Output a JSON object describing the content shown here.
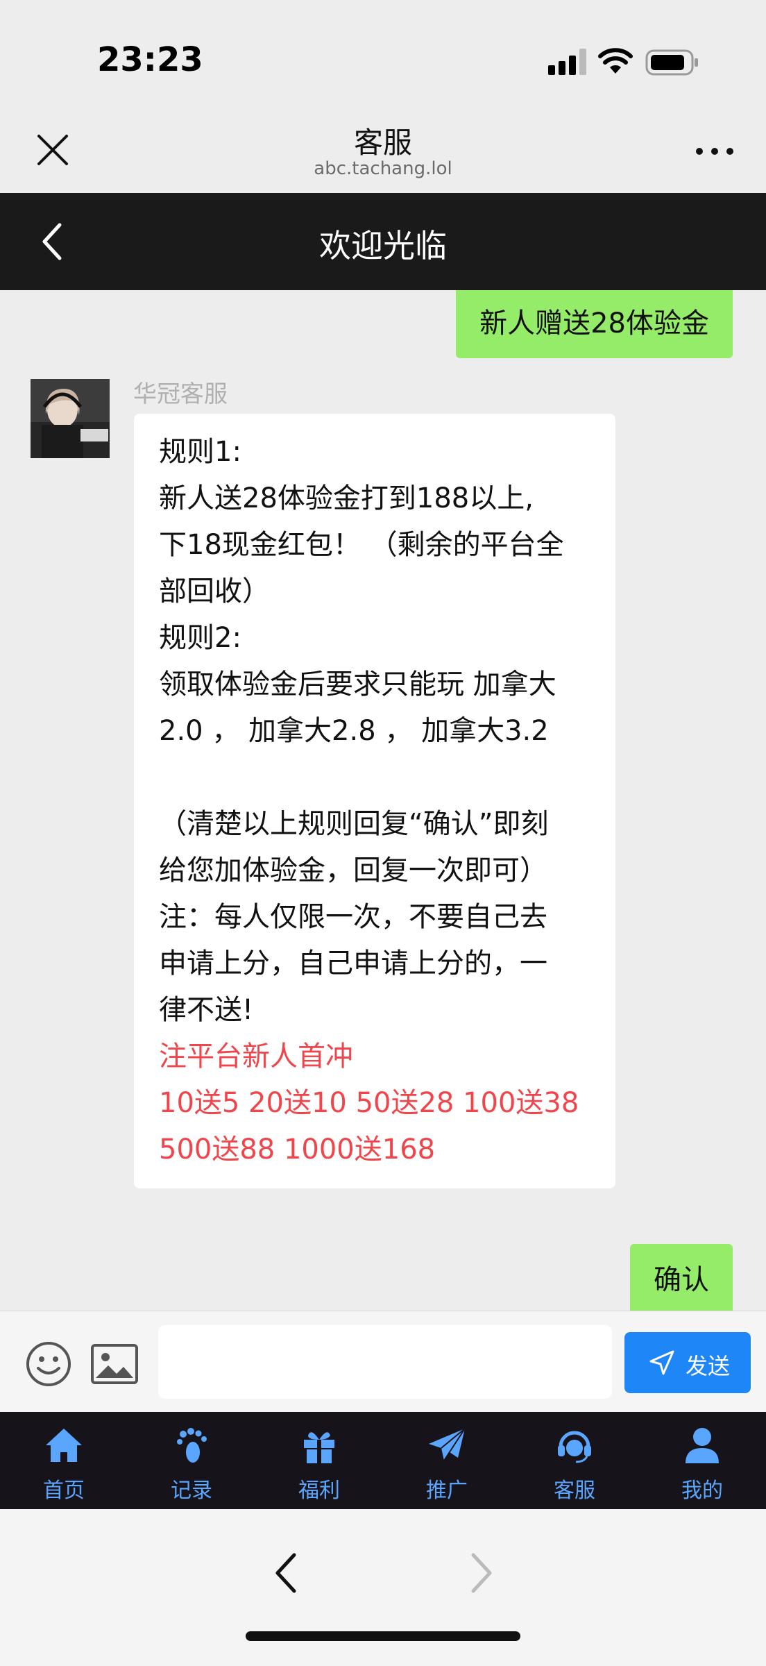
{
  "status_bar": {
    "time": "23:23"
  },
  "browser": {
    "title": "客服",
    "url": "abc.tachang.lol"
  },
  "page": {
    "title": "欢迎光临"
  },
  "chat": {
    "sent_1": "新人赠送28体验金",
    "sender_name": "华冠客服",
    "received_lines": [
      "规则1:",
      "新人送28体验金打到188以上,",
      "下18现金红包！ （剩余的平台全",
      "部回收）",
      "规则2:",
      "领取体验金后要求只能玩 加拿大",
      "2.0 ， 加拿大2.8 ， 加拿大3.2",
      "",
      "（清楚以上规则回复“确认”即刻",
      "给您加体验金，回复一次即可）",
      "注：每人仅限一次，不要自己去",
      "申请上分，自己申请上分的，一",
      "律不送!"
    ],
    "received_red_lines": [
      "注平台新人首冲",
      "10送5 20送10 50送28 100送38",
      "500送88 1000送168"
    ],
    "sent_2": "确认"
  },
  "input_bar": {
    "placeholder": "",
    "send_label": "发送"
  },
  "nav": {
    "items": [
      {
        "label": "首页",
        "icon": "home-icon"
      },
      {
        "label": "记录",
        "icon": "footprint-icon"
      },
      {
        "label": "福利",
        "icon": "gift-icon"
      },
      {
        "label": "推广",
        "icon": "paper-plane-icon"
      },
      {
        "label": "客服",
        "icon": "headset-icon"
      },
      {
        "label": "我的",
        "icon": "user-icon"
      }
    ]
  },
  "colors": {
    "accent": "#1e86f7",
    "sent_bubble": "#95ec69",
    "promo_text": "#f0464b",
    "nav_background": "#16141a",
    "nav_label": "#5aa6ff"
  }
}
